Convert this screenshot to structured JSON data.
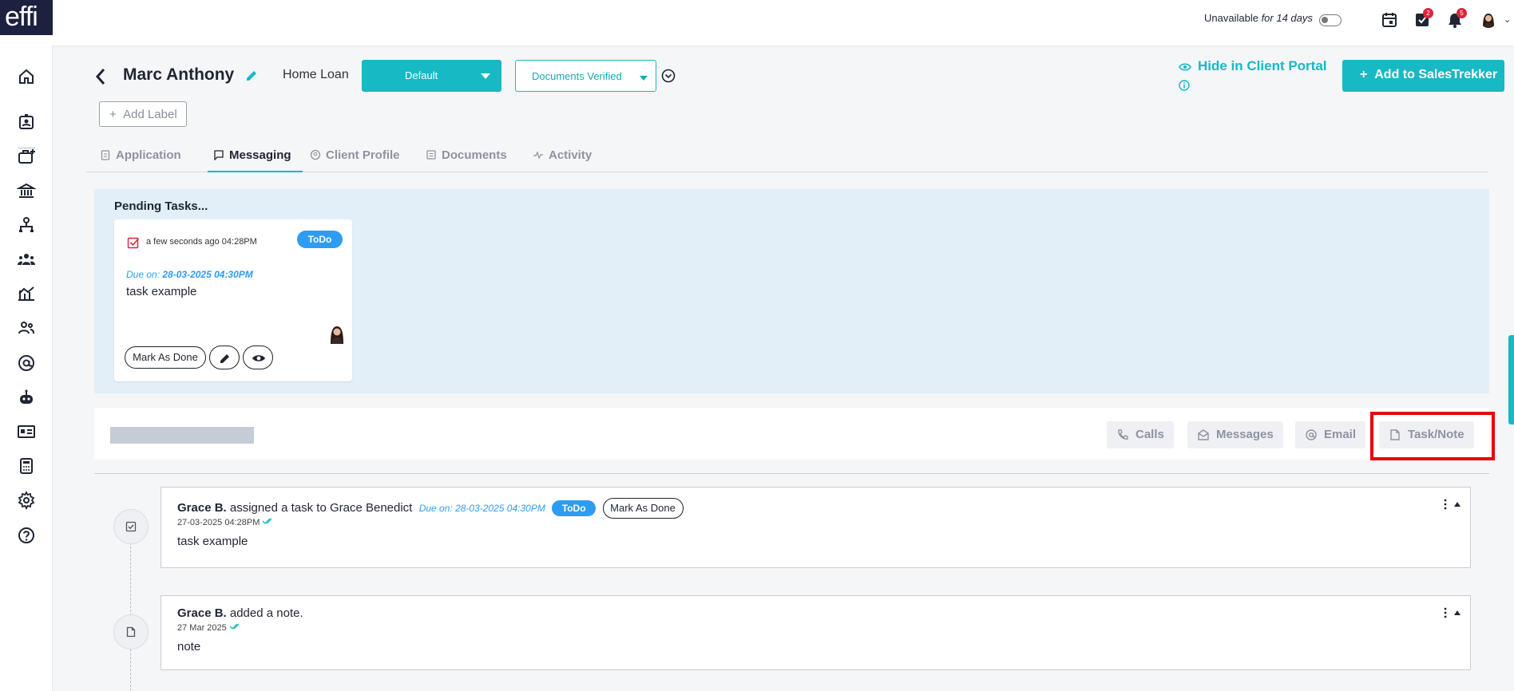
{
  "brand": {
    "logo_text": "effi",
    "accent": "#17b9c4",
    "todo_color": "#2e9cf3",
    "highlight_color": "#ea0000"
  },
  "topbar": {
    "availability_label": "Unavailable",
    "availability_duration": "for 14 days",
    "tasks_badge": "2",
    "notifications_badge": "5"
  },
  "sidebar": {
    "items": [
      "home-icon",
      "contacts-icon",
      "briefcase-add-icon",
      "bank-icon",
      "org-chart-icon",
      "team-icon",
      "analytics-icon",
      "users-icon",
      "at-sign-icon",
      "bot-icon",
      "id-card-icon",
      "calculator-icon",
      "settings-icon",
      "help-icon"
    ]
  },
  "header": {
    "client_name": "Marc Anthony",
    "loan_type": "Home Loan",
    "stage": "Default",
    "status": "Documents Verified",
    "hide_portal": "Hide in Client Portal",
    "add_salestrekker": "Add to SalesTrekker",
    "add_label": "Add Label"
  },
  "tabs": [
    {
      "label": "Application",
      "icon": "clipboard-icon"
    },
    {
      "label": "Messaging",
      "icon": "message-icon",
      "active": true
    },
    {
      "label": "Client Profile",
      "icon": "user-circle-icon"
    },
    {
      "label": "Documents",
      "icon": "documents-icon"
    },
    {
      "label": "Activity",
      "icon": "activity-icon"
    }
  ],
  "pending": {
    "title": "Pending Tasks...",
    "card": {
      "time": "a few seconds ago 04:28PM",
      "badge": "ToDo",
      "due_label": "Due on:",
      "due_value": "28-03-2025 04:30PM",
      "text": "task example",
      "mark_done": "Mark As Done"
    }
  },
  "composer": {
    "tabs": {
      "calls": "Calls",
      "messages": "Messages",
      "email": "Email",
      "task_note": "Task/Note"
    }
  },
  "timeline": [
    {
      "author": "Grace B.",
      "action": "assigned a",
      "object": "task to Grace Benedict",
      "due": "Due on: 28-03-2025 04:30PM",
      "badge": "ToDo",
      "mark_done": "Mark As Done",
      "date": "27-03-2025 04:28PM",
      "body": "task example"
    },
    {
      "author": "Grace B.",
      "action": "added a",
      "object": "note.",
      "date": "27 Mar 2025",
      "body": "note"
    }
  ]
}
